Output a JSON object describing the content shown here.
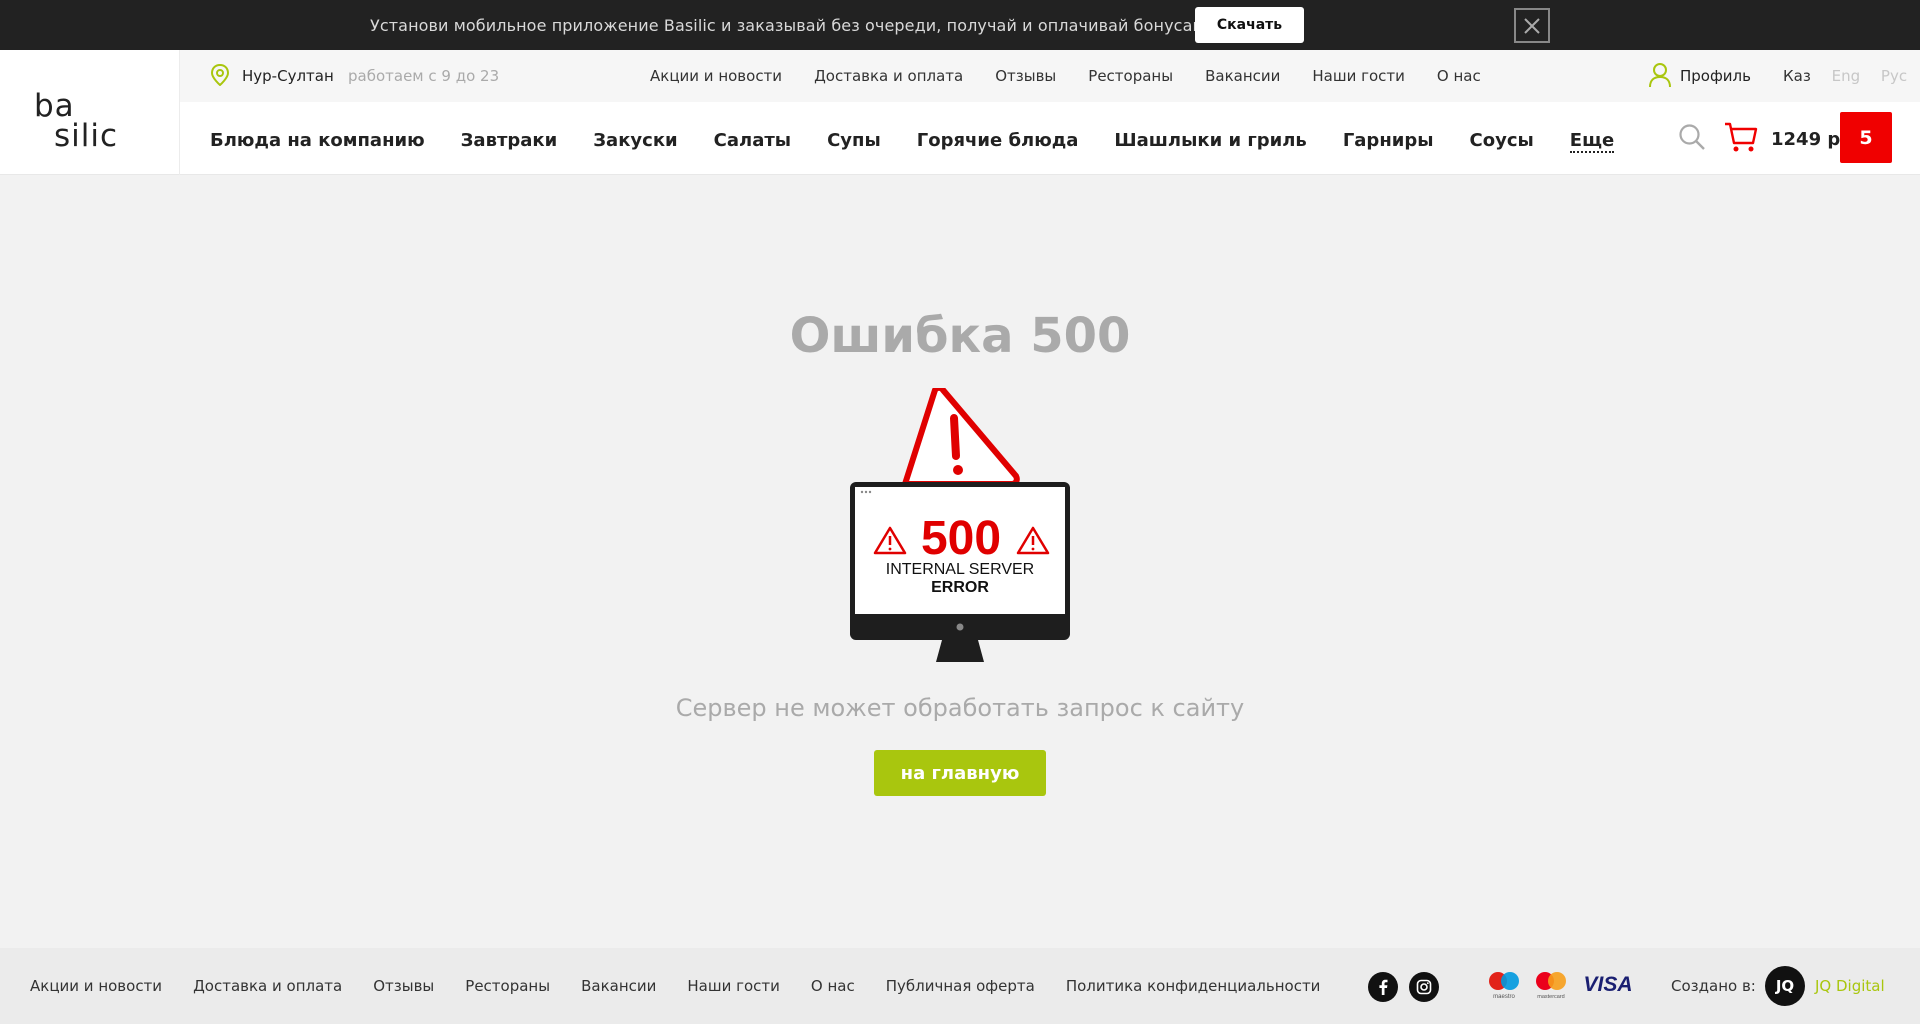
{
  "promo": {
    "text": "Установи мобильное приложение Basilic и заказывай без очереди, получай и оплачивай бонусами!",
    "button": "Скачать",
    "close_icon": "close-icon"
  },
  "header": {
    "logo_line1": "ba",
    "logo_line2": "silic",
    "city": "Нур-Султан",
    "hours": "работаем с 9 до 23",
    "top_links": [
      "Акции и новости",
      "Доставка и оплата",
      "Отзывы",
      "Рестораны",
      "Вакансии",
      "Наши гости",
      "О нас"
    ],
    "profile": "Профиль",
    "languages": [
      "Каз",
      "Eng",
      "Рус"
    ],
    "active_language": "Каз",
    "nav": [
      "Блюда на компанию",
      "Завтраки",
      "Закуски",
      "Салаты",
      "Супы",
      "Горячие блюда",
      "Шашлыки и гриль",
      "Гарниры",
      "Соусы",
      "Еще"
    ],
    "cart_sum": "1249 р",
    "cart_count": "5"
  },
  "main": {
    "title": "Ошибка 500",
    "illustration": {
      "code": "500",
      "line1": "INTERNAL SERVER",
      "line2": "ERROR"
    },
    "subtitle": "Сервер не может обработать запрос к сайту",
    "button": "на главную"
  },
  "footer": {
    "links": [
      "Акции и новости",
      "Доставка и оплата",
      "Отзывы",
      "Рестораны",
      "Вакансии",
      "Наши гости",
      "О нас",
      "Публичная оферта",
      "Политика конфиденциальности"
    ],
    "social": [
      "facebook-icon",
      "instagram-icon"
    ],
    "payments": {
      "maestro": "maestro",
      "mastercard": "mastercard",
      "visa": "VISA"
    },
    "made_by": "Создано в:",
    "agency_mark": "JQ",
    "agency": "JQ Digital"
  },
  "colors": {
    "accent_green": "#a9c60e",
    "cart_red": "#f00000",
    "promo_bg": "#222222"
  }
}
